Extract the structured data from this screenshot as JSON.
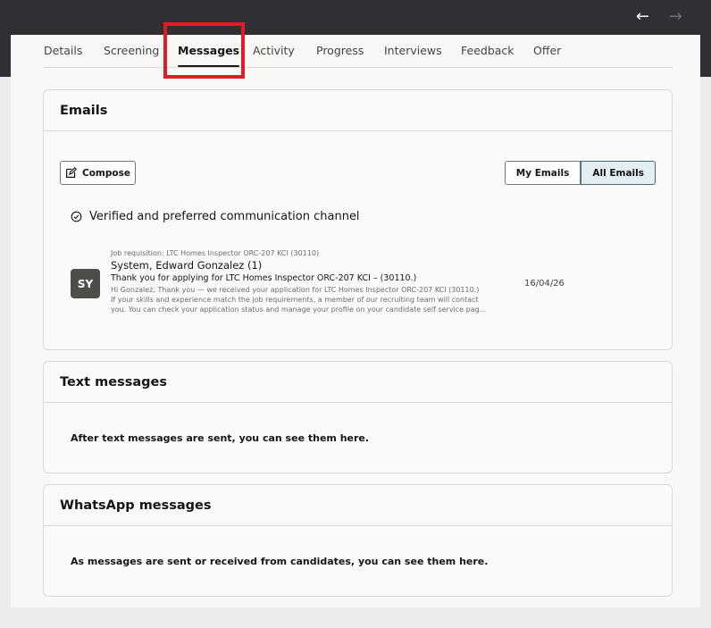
{
  "nav": {
    "back_icon": "arrow-left-icon",
    "forward_icon": "arrow-right-icon"
  },
  "tabs": [
    {
      "label": "Details"
    },
    {
      "label": "Screening"
    },
    {
      "label": "Messages",
      "active": true
    },
    {
      "label": "Activity"
    },
    {
      "label": "Progress"
    },
    {
      "label": "Interviews"
    },
    {
      "label": "Feedback"
    },
    {
      "label": "Offer"
    }
  ],
  "emails": {
    "title": "Emails",
    "compose_label": "Compose",
    "filter": {
      "my_label": "My Emails",
      "all_label": "All Emails",
      "selected": "All Emails"
    },
    "verified_text": "Verified and preferred communication channel",
    "items": [
      {
        "avatar": "SY",
        "requisition": "Job requisition: LTC Homes Inspector ORC-207 KCI (30110)",
        "sender": "System, Edward Gonzalez (1)",
        "subject": "Thank you for applying for LTC Homes Inspector ORC-207 KCI – (30110.)",
        "preview_lines": [
          "Hi Gonzalez, Thank you — we received your application for LTC Homes Inspector ORC-207 KCI (30110.)",
          "If your skills and experience match the job requirements, a member of our recruiting team will contact",
          "you. You can check your application status and manage your profile on your candidate self service pag..."
        ],
        "date": "16/04/26"
      }
    ]
  },
  "text_messages": {
    "title": "Text messages",
    "empty_text": "After text messages are sent, you can see them here."
  },
  "whatsapp": {
    "title": "WhatsApp messages",
    "empty_text": "As messages are sent or received from candidates, you can see them here."
  },
  "colors": {
    "header_bg": "#312f34",
    "highlight": "#e31c23",
    "selected_toggle": "#e4eef2"
  }
}
